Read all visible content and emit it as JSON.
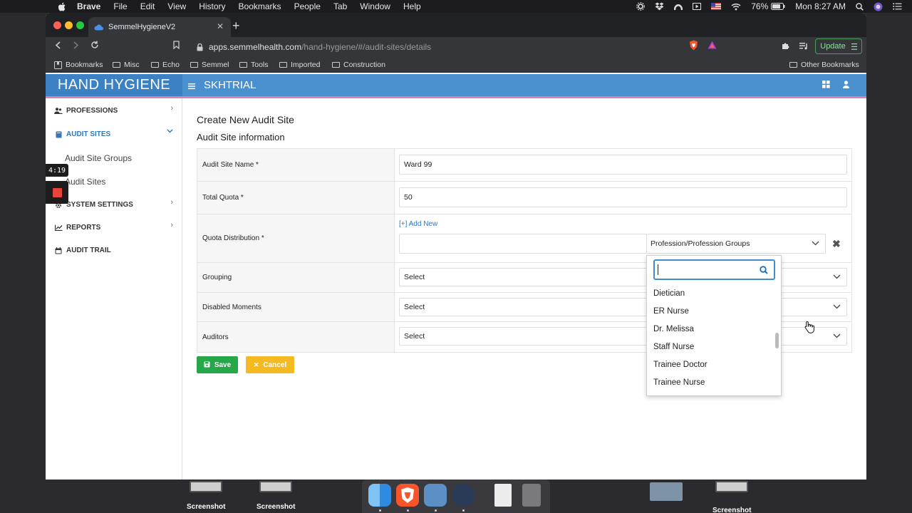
{
  "os_menubar": {
    "app_name": "Brave",
    "menus": [
      "File",
      "Edit",
      "View",
      "History",
      "Bookmarks",
      "People",
      "Tab",
      "Window",
      "Help"
    ],
    "battery": "76%",
    "clock": "Mon 8:27 AM"
  },
  "browser": {
    "tab_title": "SemmelHygieneV2",
    "url_host": "apps.semmelhealth.com",
    "url_path": "/hand-hygiene/#/audit-sites/details",
    "update_label": "Update",
    "bookmarks": [
      "Bookmarks",
      "Misc",
      "Echo",
      "Semmel",
      "Tools",
      "Imported",
      "Construction"
    ],
    "other_bookmarks": "Other Bookmarks"
  },
  "app": {
    "brand": "HAND HYGIENE",
    "org": "SKHTRIAL"
  },
  "sidebar": {
    "professions": "PROFESSIONS",
    "audit_sites": "AUDIT SITES",
    "audit_site_groups": "Audit Site Groups",
    "audit_sites_sub": "Audit Sites",
    "system_settings": "SYSTEM SETTINGS",
    "reports": "REPORTS",
    "audit_trail": "AUDIT TRAIL"
  },
  "recorder": {
    "time": "4:19"
  },
  "form": {
    "page_title": "Create New Audit Site",
    "section_title": "Audit Site information",
    "site_name_label": "Audit Site Name *",
    "site_name_value": "Ward 99",
    "total_quota_label": "Total Quota *",
    "total_quota_value": "50",
    "quota_distribution_label": "Quota Distribution *",
    "add_new": "[+] Add New",
    "profession_placeholder": "Profession/Profession Groups",
    "grouping_label": "Grouping",
    "grouping_value": "Select",
    "disabled_moments_label": "Disabled Moments",
    "disabled_moments_value": "Select",
    "auditors_label": "Auditors",
    "auditors_value": "Select",
    "save": "Save",
    "cancel": "Cancel"
  },
  "dropdown": {
    "search_value": "",
    "options": [
      "Dietician",
      "ER Nurse",
      "Dr. Melissa",
      "Staff Nurse",
      "Trainee Doctor",
      "Trainee Nurse"
    ]
  },
  "dock": {
    "left_labels": [
      "Screenshot",
      "Screenshot"
    ],
    "right_label": "Screenshot"
  },
  "colors": {
    "header_blue": "#4a8fce",
    "brand_blue": "#3c81c4",
    "save_green": "#26a84a",
    "cancel_yellow": "#f5b921",
    "link_blue": "#2f77c0"
  }
}
